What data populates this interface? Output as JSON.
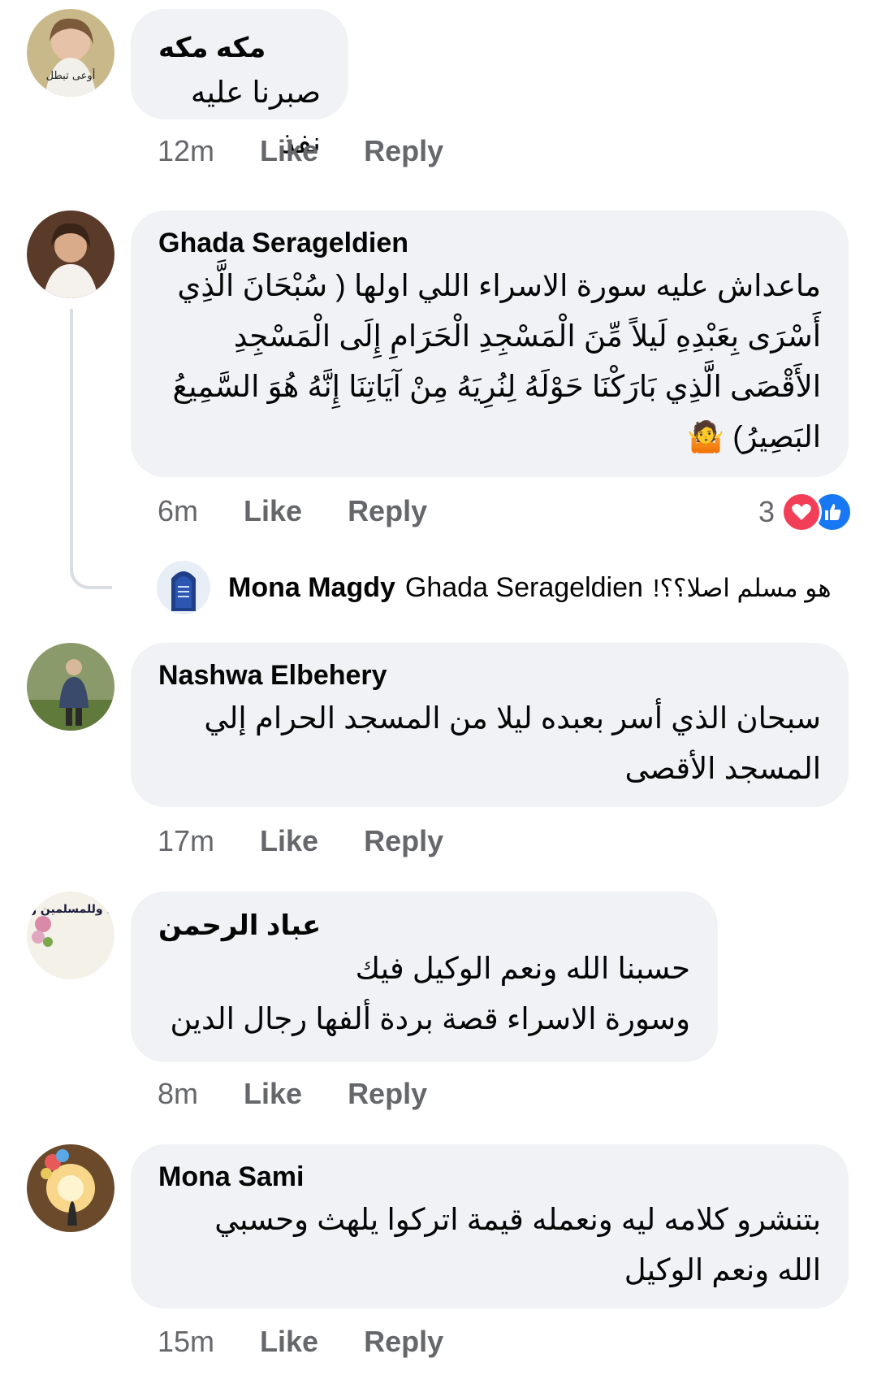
{
  "comments": [
    {
      "author": "مكه مكه",
      "avatar_overlay_text": "أوعى تبطل",
      "text": "صبرنا عليه نفذ",
      "time": "12m",
      "like": "Like",
      "reply": "Reply"
    },
    {
      "author": "Ghada Serageldien",
      "text": "ماعداش عليه سورة الاسراء اللي اولها ( سُبْحَانَ الَّذِي\nأَسْرَى بِعَبْدِهِ لَيلاً مِّنَ الْمَسْجِدِ الْحَرَامِ إِلَى الْمَسْجِدِ\nالأَقْصَى الَّذِي بَارَكْنَا حَوْلَهُ لِنُرِيَهُ مِنْ آيَاتِنَا إِنَّهُ هُوَ السَّمِيعُ\nالبَصِيرُ) 🤷",
      "time": "6m",
      "like": "Like",
      "reply": "Reply",
      "reaction_count": "3",
      "reply_item": {
        "author": "Mona Magdy",
        "mention": "Ghada Serageldien",
        "text": "هو مسلم اصلا؟؟!"
      }
    },
    {
      "author": "Nashwa Elbehery",
      "text": "سبحان الذي أسر بعبده ليلا من المسجد الحرام إلي\nالمسجد الأقصى",
      "time": "17m",
      "like": "Like",
      "reply": "Reply"
    },
    {
      "author": "عباد الرحمن",
      "avatar_overlay_text": "اللهم اغفر لي وللمسلمين والمسلمات",
      "text": "حسبنا الله ونعم الوكيل فيك\nوسورة الاسراء قصة بردة ألفها رجال الدين",
      "time": "8m",
      "like": "Like",
      "reply": "Reply"
    },
    {
      "author": "Mona Sami",
      "text": "بتنشرو كلامه ليه ونعمله قيمة اتركوا يلهث وحسبي\nالله ونعم الوكيل",
      "time": "15m",
      "like": "Like",
      "reply": "Reply"
    }
  ],
  "colors": {
    "bubble": "#f0f2f5",
    "meta": "#65676b",
    "like_blue": "#1877f2",
    "love_red": "#f33e58"
  }
}
